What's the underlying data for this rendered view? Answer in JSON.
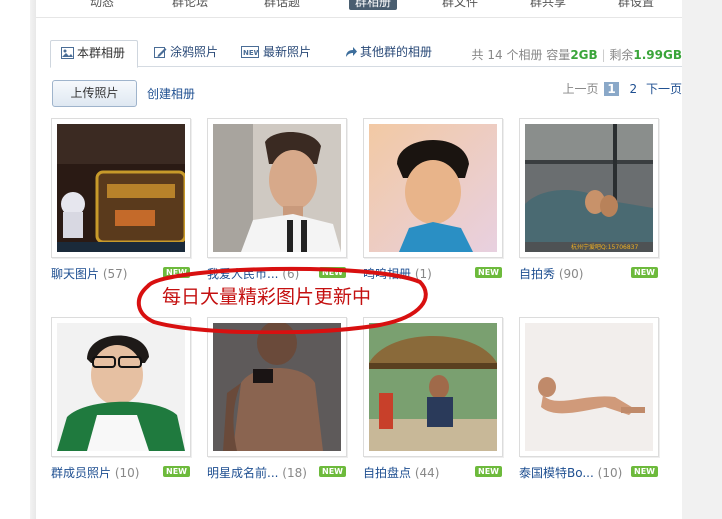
{
  "topnav": {
    "items": [
      "动态",
      "群论坛",
      "群话题",
      "群相册",
      "群文件",
      "群共享",
      "群设置"
    ],
    "active_index": 3
  },
  "tabs": [
    {
      "label": "本群相册",
      "icon": "album-icon",
      "active": true
    },
    {
      "label": "涂鸦照片",
      "icon": "pencil-icon",
      "active": false
    },
    {
      "label": "最新照片",
      "icon": "new-icon",
      "active": false
    },
    {
      "label": "其他群的相册",
      "icon": "share-arrow-icon",
      "active": false
    }
  ],
  "stats": {
    "total_prefix": "共",
    "total_count": "14",
    "total_suffix": "个相册",
    "capacity_label": "容量",
    "capacity_value": "2GB",
    "remaining_label": "剩余",
    "remaining_value": "1.99GB"
  },
  "actions": {
    "upload_label": "上传照片",
    "create_label": "创建相册"
  },
  "pager": {
    "prev_label": "上一页",
    "current": "1",
    "next_page": "2",
    "next_label": "下一页"
  },
  "albums": [
    {
      "name": "聊天图片",
      "count": "(57)",
      "badge": "NEW"
    },
    {
      "name": "我爱人民币...",
      "count": "(6)",
      "badge": "NEW"
    },
    {
      "name": "呜呜相册",
      "count": "(1)",
      "badge": "NEW"
    },
    {
      "name": "自拍秀",
      "count": "(90)",
      "badge": "NEW"
    },
    {
      "name": "群成员照片",
      "count": "(10)",
      "badge": "NEW"
    },
    {
      "name": "明星成名前...",
      "count": "(18)",
      "badge": "NEW"
    },
    {
      "name": "自拍盘点",
      "count": "(44)",
      "badge": "NEW"
    },
    {
      "name": "泰国模特Bo...",
      "count": "(10)",
      "badge": "NEW"
    }
  ],
  "watermarks": {
    "album4": "杭州宁爱吧Q:15706837"
  },
  "promo": {
    "text": "每日大量精彩图片更新中",
    "color": "#c41010"
  },
  "colors": {
    "link": "#1e4f91",
    "badge": "#6dba3c",
    "accent_green": "#3aa53a"
  }
}
